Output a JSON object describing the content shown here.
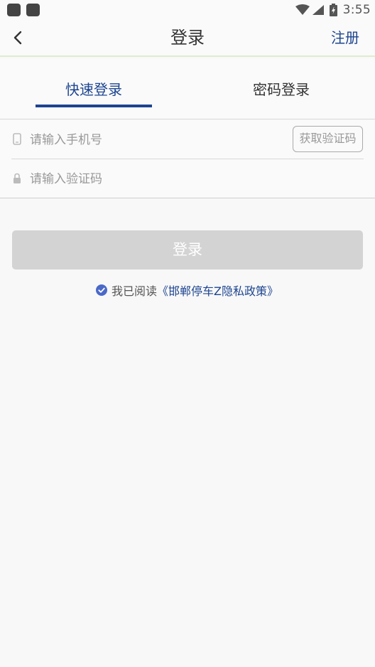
{
  "status_bar": {
    "time": "3:55"
  },
  "nav": {
    "title": "登录",
    "register": "注册"
  },
  "tabs": [
    {
      "label": "快速登录",
      "active": true
    },
    {
      "label": "密码登录",
      "active": false
    }
  ],
  "form": {
    "phone_placeholder": "请输入手机号",
    "code_placeholder": "请输入验证码",
    "get_code_label": "获取验证码"
  },
  "login_button": "登录",
  "agreement": {
    "prefix": "我已阅读",
    "link": "《邯郸停车Z隐私政策》",
    "checked": true
  },
  "colors": {
    "accent": "#1d4590",
    "checkbox": "#4a69c8",
    "button_disabled": "#d3d3d3",
    "nav_border": "#dfeccd"
  }
}
